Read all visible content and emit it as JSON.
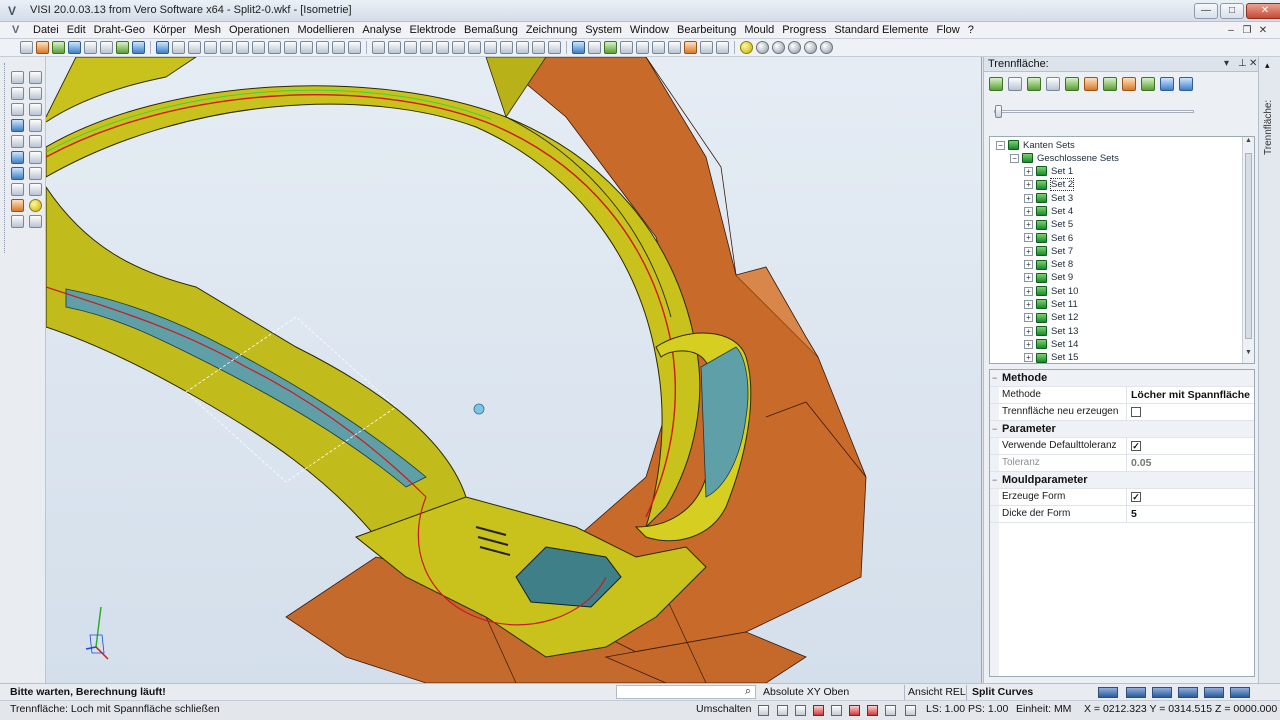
{
  "window": {
    "title": "VISI 20.0.03.13 from Vero Software x64 - Split2-0.wkf - [Isometrie]",
    "logo": "V",
    "minimize": "—",
    "maximize": "□",
    "close": "✕"
  },
  "menu": {
    "items": [
      "Datei",
      "Edit",
      "Draht-Geo",
      "Körper",
      "Mesh",
      "Operationen",
      "Modellieren",
      "Analyse",
      "Elektrode",
      "Bemaßung",
      "Zeichnung",
      "System",
      "Window",
      "Bearbeitung",
      "Mould",
      "Progress",
      "Standard Elemente",
      "Flow",
      "?"
    ]
  },
  "panel": {
    "title": "Trennfläche:",
    "side_tab": "Trennfläche:",
    "tree": {
      "root": "Kanten Sets",
      "group": "Geschlossene Sets",
      "sets": [
        "Set 1",
        "Set 2",
        "Set 3",
        "Set 4",
        "Set 5",
        "Set 6",
        "Set 7",
        "Set 8",
        "Set 9",
        "Set 10",
        "Set 11",
        "Set 12",
        "Set 13",
        "Set 14",
        "Set 15"
      ],
      "selected_index": 1
    },
    "props": {
      "methode_section": "Methode",
      "methode_label": "Methode",
      "methode_value": "Löcher mit Spannfläche",
      "neu_label": "Trennfläche neu erzeugen",
      "neu_checked": false,
      "parameter_section": "Parameter",
      "default_tol_label": "Verwende Defaulttoleranz",
      "default_tol_checked": true,
      "toleranz_label": "Toleranz",
      "toleranz_value": "0.05",
      "mould_section": "Mouldparameter",
      "form_label": "Erzeuge Form",
      "form_checked": true,
      "dicke_label": "Dicke der Form",
      "dicke_value": "5"
    }
  },
  "status": {
    "message": "Bitte warten, Berechnung läuft!",
    "view_mode": "Absolute XY Oben",
    "ansicht": "Ansicht REL",
    "command": "Split Curves",
    "hint": "Trennfläche: Loch mit Spannfläche schließen",
    "umschalten": "Umschalten",
    "ls_ps": "LS: 1.00 PS: 1.00",
    "einheit": "Einheit: MM",
    "coords": "X = 0212.323 Y = 0314.515 Z = 0000.000"
  },
  "colors": {
    "part_yellow": "#c9c21d",
    "surface_orange": "#c86b2a",
    "hole_teal": "#5f9fa8",
    "split_curve_red": "#d01818",
    "edge_green": "#3ed23a"
  }
}
